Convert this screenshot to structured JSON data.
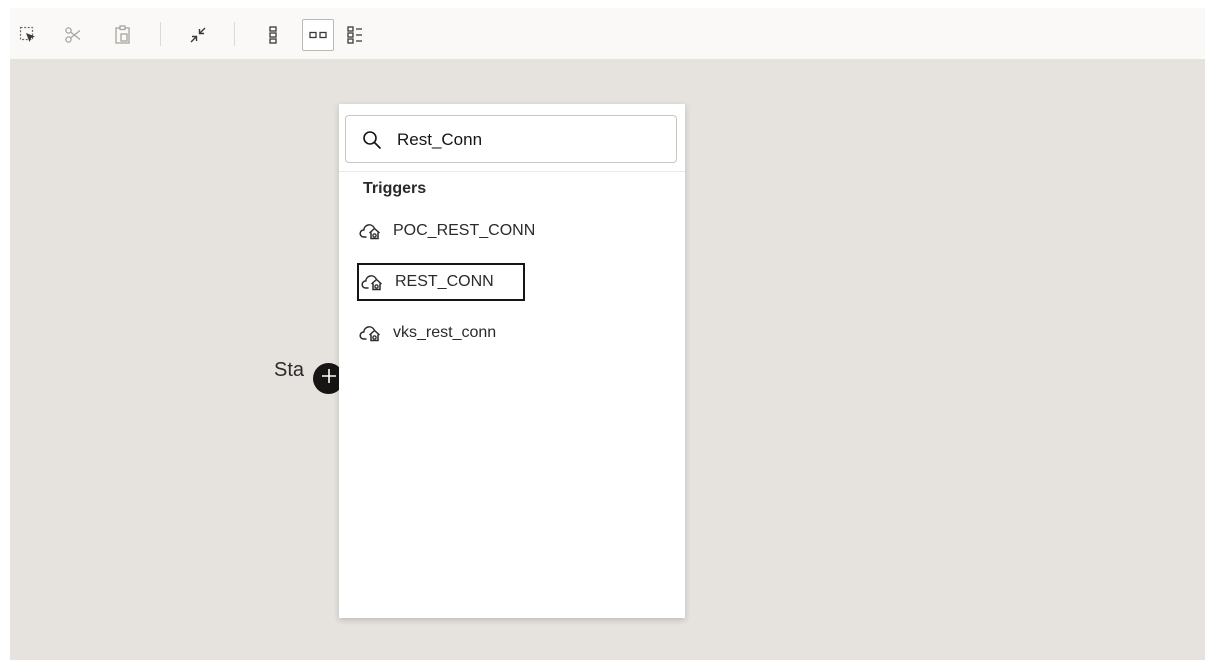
{
  "toolbar": {
    "buttons": [
      {
        "icon": "select-icon",
        "state": "default"
      },
      {
        "icon": "cut-icon",
        "state": "disabled"
      },
      {
        "icon": "paste-icon",
        "state": "disabled"
      },
      {
        "icon": "collapse-icon",
        "state": "default"
      },
      {
        "icon": "vertical-layout-icon",
        "state": "default"
      },
      {
        "icon": "horizontal-layout-icon",
        "state": "selected"
      },
      {
        "icon": "pseudo-layout-icon",
        "state": "default"
      }
    ]
  },
  "canvas": {
    "start_label": "Sta"
  },
  "popup": {
    "search": {
      "value": "Rest_Conn",
      "icon": "search-icon"
    },
    "section_heading": "Triggers",
    "items": [
      {
        "label": "POC_REST_CONN",
        "icon": "rest-adapter-icon",
        "focused": false
      },
      {
        "label": "REST_CONN",
        "icon": "rest-adapter-icon",
        "focused": true
      },
      {
        "label": "vks_rest_conn",
        "icon": "rest-adapter-icon",
        "focused": false
      }
    ]
  },
  "colors": {
    "canvas_background": "#e6e3df",
    "toolbar_background": "#fbf9f8",
    "text": "#161513",
    "focus_outline": "#161513"
  }
}
